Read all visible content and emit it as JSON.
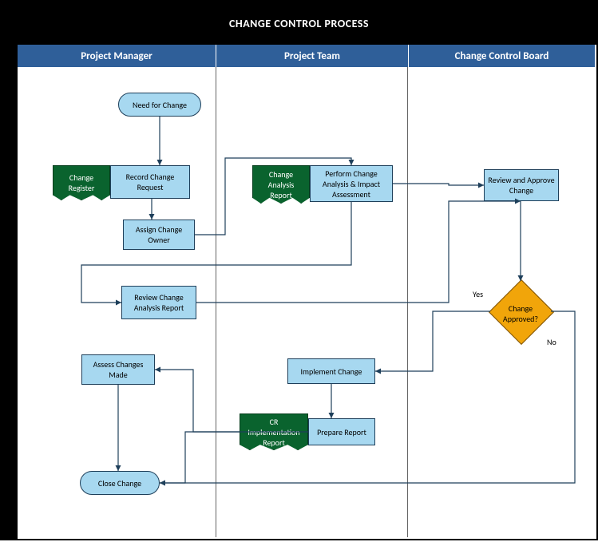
{
  "title": "CHANGE CONTROL PROCESS",
  "lanes": [
    "Project Manager",
    "Project Team",
    "Change Control Board"
  ],
  "nodes": {
    "start": "Need for Change",
    "record": "Record Change Request",
    "assign": "Assign Change Owner",
    "analysis": "Perform Change Analysis & Impact Assessment",
    "reviewAnalysis": "Review Change Analysis Report",
    "reviewApprove": "Review and Approve Change",
    "decision": "Change Approved?",
    "implement": "Implement Change",
    "prepare": "Prepare Report",
    "assess": "Assess Changes Made",
    "close": "Close Change"
  },
  "docs": {
    "register": "Change Register",
    "analysisReport": "Change Analysis Report",
    "crReport": "CR Implementation Report"
  },
  "labels": {
    "yes": "Yes",
    "no": "No"
  },
  "chart_data": {
    "type": "flowchart-swimlane",
    "title": "CHANGE CONTROL PROCESS",
    "lanes": [
      "Project Manager",
      "Project Team",
      "Change Control Board"
    ],
    "nodes": [
      {
        "id": "start",
        "lane": "Project Manager",
        "type": "terminator",
        "label": "Need for Change"
      },
      {
        "id": "record",
        "lane": "Project Manager",
        "type": "process",
        "label": "Record Change Request",
        "artifact": "Change Register"
      },
      {
        "id": "assign",
        "lane": "Project Manager",
        "type": "process",
        "label": "Assign Change Owner"
      },
      {
        "id": "analysis",
        "lane": "Project Team",
        "type": "process",
        "label": "Perform Change Analysis & Impact Assessment",
        "artifact": "Change Analysis Report"
      },
      {
        "id": "reviewAnalysis",
        "lane": "Project Manager",
        "type": "process",
        "label": "Review Change Analysis Report"
      },
      {
        "id": "reviewApprove",
        "lane": "Change Control Board",
        "type": "process",
        "label": "Review and Approve Change"
      },
      {
        "id": "decision",
        "lane": "Change Control Board",
        "type": "decision",
        "label": "Change Approved?"
      },
      {
        "id": "implement",
        "lane": "Project Team",
        "type": "process",
        "label": "Implement Change"
      },
      {
        "id": "prepare",
        "lane": "Project Team",
        "type": "process",
        "label": "Prepare Report",
        "artifact": "CR Implementation Report"
      },
      {
        "id": "assess",
        "lane": "Project Manager",
        "type": "process",
        "label": "Assess Changes Made"
      },
      {
        "id": "close",
        "lane": "Project Manager",
        "type": "terminator",
        "label": "Close Change"
      }
    ],
    "edges": [
      {
        "from": "start",
        "to": "record"
      },
      {
        "from": "record",
        "to": "assign"
      },
      {
        "from": "assign",
        "to": "analysis"
      },
      {
        "from": "analysis",
        "to": "reviewApprove"
      },
      {
        "from": "analysis",
        "to": "reviewAnalysis"
      },
      {
        "from": "reviewAnalysis",
        "to": "reviewApprove"
      },
      {
        "from": "reviewApprove",
        "to": "decision"
      },
      {
        "from": "decision",
        "to": "implement",
        "label": "Yes"
      },
      {
        "from": "decision",
        "to": "close",
        "label": "No"
      },
      {
        "from": "implement",
        "to": "prepare"
      },
      {
        "from": "prepare",
        "to": "assess"
      },
      {
        "from": "assess",
        "to": "close"
      }
    ]
  }
}
